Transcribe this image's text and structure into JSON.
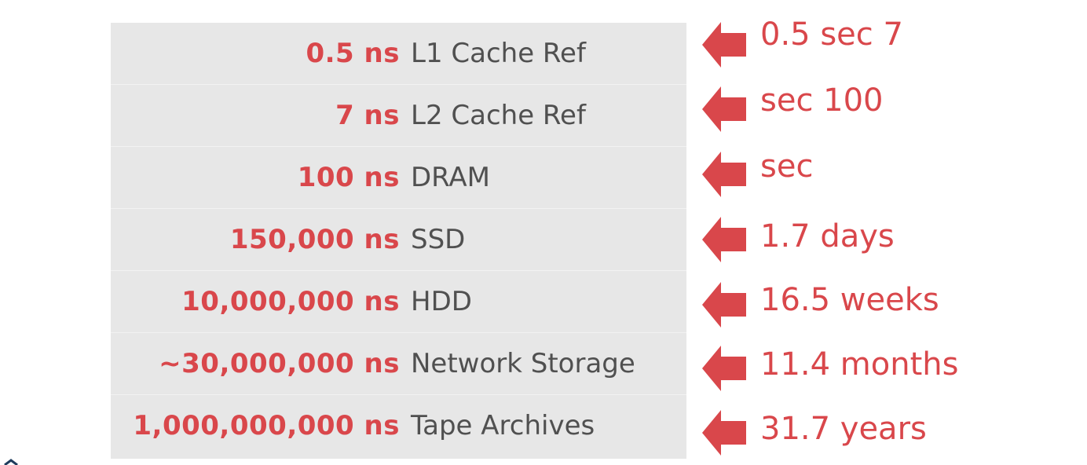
{
  "rows": [
    {
      "value": "0.5 ns",
      "label": "L1 Cache Ref"
    },
    {
      "value": "7 ns",
      "label": "L2 Cache Ref"
    },
    {
      "value": "100 ns",
      "label": "DRAM"
    },
    {
      "value": "150,000 ns",
      "label": "SSD"
    },
    {
      "value": "10,000,000 ns",
      "label": "HDD"
    },
    {
      "value": "~30,000,000 ns",
      "label": "Network Storage"
    },
    {
      "value": "1,000,000,000 ns",
      "label": "Tape Archives"
    }
  ],
  "notes": [
    "0.5 sec 7",
    "sec  100",
    "sec",
    "1.7 days",
    "16.5 weeks",
    "11.4 months",
    "31.7 years"
  ],
  "colors": {
    "accent": "#d9474b",
    "table_bg": "#e7e7e7",
    "label_text": "#505050"
  },
  "icons": {
    "arrow": "left-arrow-icon"
  }
}
